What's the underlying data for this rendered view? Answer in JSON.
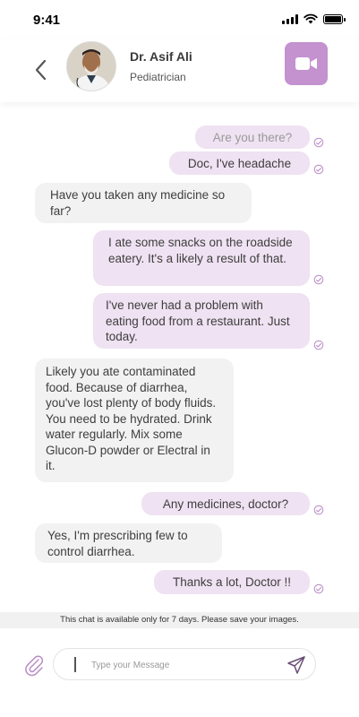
{
  "status_bar": {
    "time": "9:41"
  },
  "header": {
    "doctor_name": "Dr. Asif Ali",
    "doctor_role": "Pediatrician",
    "accent_color": "#c392cf"
  },
  "messages": [
    {
      "direction": "out",
      "text": "Are you there?",
      "read": true,
      "faded": true
    },
    {
      "direction": "out",
      "text": "Doc, I've headache",
      "read": true
    },
    {
      "direction": "in",
      "text": "Have you taken any medicine so far?"
    },
    {
      "direction": "out",
      "text": "I ate some snacks on the roadside eatery. It's a likely a result of that.",
      "read": true
    },
    {
      "direction": "out",
      "text": "I've never had a problem with eating food from a restaurant. Just today.",
      "read": true
    },
    {
      "direction": "in",
      "text": "Likely you ate contaminated food. Because of diarrhea, you've lost plenty of body fluids. You need to be hydrated. Drink water regularly. Mix some Glucon-D powder or Electral in it."
    },
    {
      "direction": "out",
      "text": "Any medicines, doctor?",
      "read": true
    },
    {
      "direction": "in",
      "text": "Yes, I'm prescribing few to control diarrhea."
    },
    {
      "direction": "out",
      "text": "Thanks a lot, Doctor !!",
      "read": true
    }
  ],
  "notice": "This chat is available only for 7 days. Please save your images.",
  "composer": {
    "placeholder": "Type your Message",
    "value": ""
  },
  "colors": {
    "outgoing_bubble": "#efe2f2",
    "incoming_bubble": "#f2f2f2",
    "tick": "#b98cc6"
  }
}
